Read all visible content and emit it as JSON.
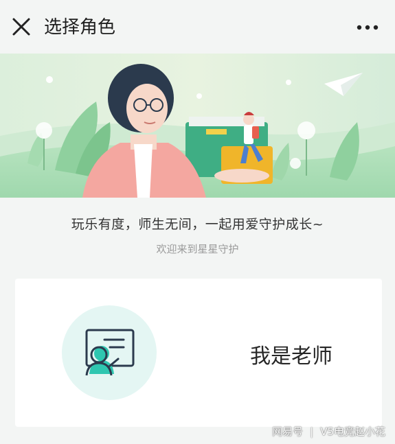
{
  "header": {
    "title": "选择角色",
    "close_icon": "close-icon",
    "more_icon": "more-icon"
  },
  "banner": {
    "illustration": "teacher-holding-student-illustration"
  },
  "intro": {
    "slogan": "玩乐有度，师生无间，一起用爱守护成长~",
    "welcome": "欢迎来到星星守护"
  },
  "role_card": {
    "label": "我是老师",
    "icon": "teacher-at-board-icon"
  },
  "watermark": {
    "source": "网易号",
    "author": "V5电竞赵小花"
  },
  "colors": {
    "accent": "#2fc6b0",
    "icon_bg": "#e4f6f3",
    "page_bg": "#f3f5f4"
  }
}
